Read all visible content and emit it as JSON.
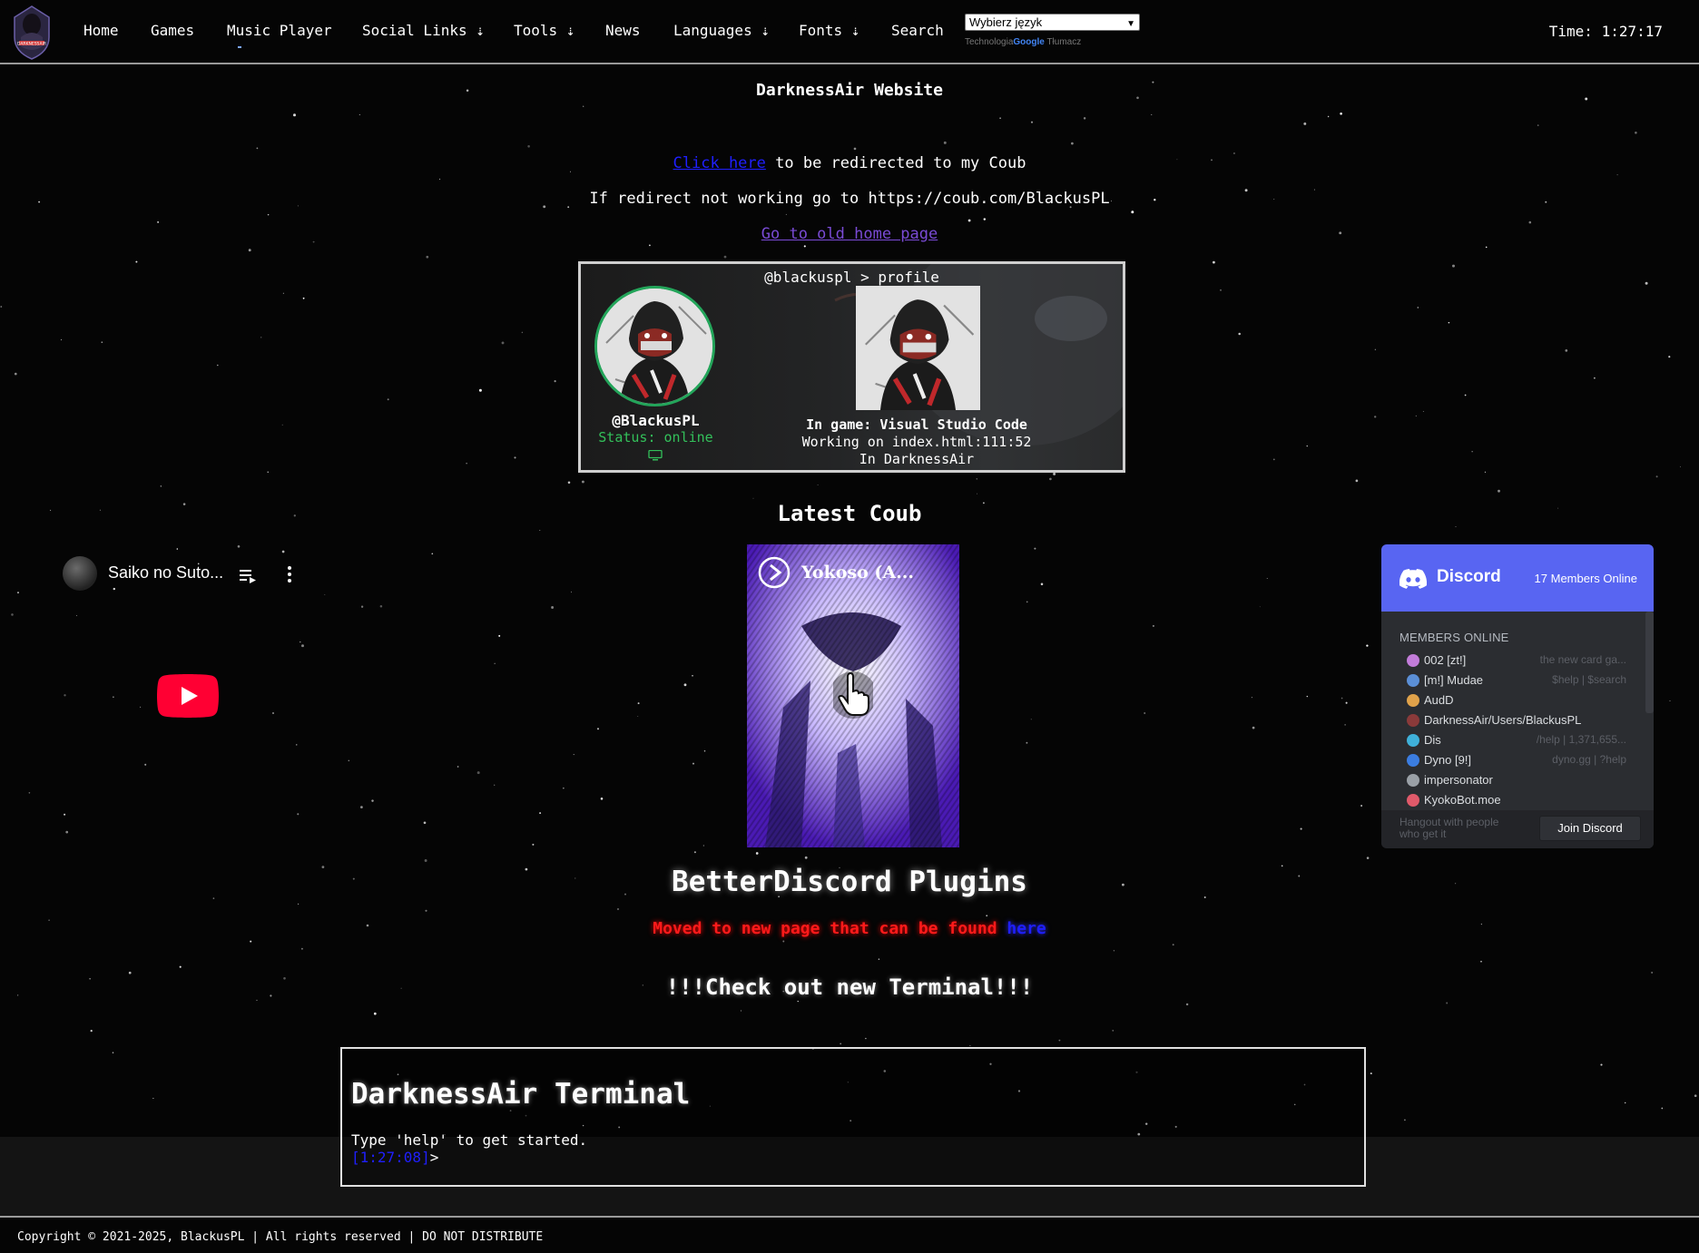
{
  "nav": {
    "items": [
      "Home",
      "Games",
      "Music Player",
      "Social Links ⇣",
      "Tools ⇣",
      "News",
      "Languages ⇣",
      "Fonts ⇣",
      "Search"
    ],
    "language_select": "Wybierz język",
    "translate_credit_prefix": "Technologia",
    "translate_credit_brand": "Google",
    "translate_credit_suffix": "Tłumacz",
    "clock": "Time: 1:27:17"
  },
  "main": {
    "site_title": "DarknessAir Website",
    "redirect_link": "Click here",
    "redirect_text": " to be redirected to my Coub",
    "redirect_fallback": "If redirect not working go to https://coub.com/BlackusPL",
    "old_home_link": "Go to old home page"
  },
  "profile": {
    "header": "@blackuspl > profile",
    "username": "@BlackusPL",
    "status": "Status: online",
    "activity_title": "In game: Visual Studio Code",
    "activity_detail": "Working on index.html:111:52",
    "activity_state": "In DarknessAir"
  },
  "coub": {
    "heading": "Latest Coub",
    "video_title": "Yokoso (A..."
  },
  "betterdiscord": {
    "title": "BetterDiscord Plugins",
    "moved_text": "Moved to new page that can be found ",
    "moved_link": "here"
  },
  "terminal": {
    "promo": "!!!Check out new Terminal!!!",
    "title": "DarknessAir Terminal",
    "help_text": "Type 'help' to get started.",
    "prompt_time": "[1:27:08]",
    "prompt_symbol": ">"
  },
  "youtube": {
    "video_title": "Saiko no Suto..."
  },
  "discord": {
    "brand": "Discord",
    "members_online_count": "17 Members Online",
    "section_label": "MEMBERS ONLINE",
    "members": [
      {
        "name": "002 [zt!]",
        "game": "the new card ga...",
        "avatar_color": "#c27cd9"
      },
      {
        "name": "[m!] Mudae",
        "game": "$help | $search",
        "avatar_color": "#5b8fd6"
      },
      {
        "name": "AudD",
        "game": "",
        "avatar_color": "#e0a24a"
      },
      {
        "name": "DarknessAir/Users/BlackusPL",
        "game": "",
        "avatar_color": "#8a3a3a"
      },
      {
        "name": "Dis",
        "game": "/help | 1,371,655...",
        "avatar_color": "#3fb0d9"
      },
      {
        "name": "Dyno [9!]",
        "game": "dyno.gg | ?help",
        "avatar_color": "#3b7de0"
      },
      {
        "name": "impersonator",
        "game": "",
        "avatar_color": "#9aa0a6"
      },
      {
        "name": "KyokoBot.moe",
        "game": "",
        "avatar_color": "#e05a6a"
      }
    ],
    "footer_text": "Hangout with people who get it",
    "join_button": "Join Discord"
  },
  "footer": {
    "copyright": "Copyright © 2021-2025, BlackusPL | All rights reserved | DO NOT DISTRIBUTE"
  },
  "colors": {
    "background": "#050505",
    "link_blue": "#1f1fff",
    "visited_purple": "#7a4bd6",
    "online_green": "#33c05a",
    "alert_red": "#ff1a1a",
    "discord_blurple": "#5865f2"
  }
}
